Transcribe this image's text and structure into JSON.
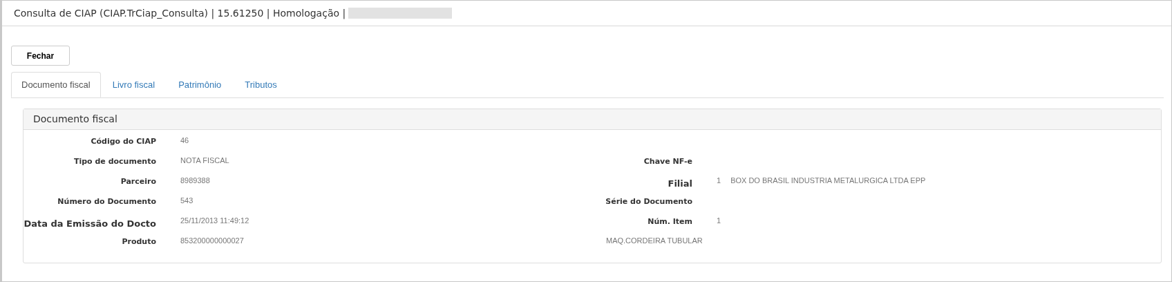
{
  "window": {
    "title": "Consulta de CIAP (CIAP.TrCiap_Consulta) | 15.61250 | Homologação |",
    "redacted": true
  },
  "buttons": [
    {
      "label": "Fechar"
    }
  ],
  "tabs": [
    {
      "label": "Documento fiscal",
      "selected": true
    },
    {
      "label": "Livro fiscal",
      "selected": false
    },
    {
      "label": "Patrimônio",
      "selected": false
    },
    {
      "label": "Tributos",
      "selected": false
    }
  ],
  "panel": {
    "title": "Documento fiscal",
    "rows": [
      {
        "left": {
          "label": "Código do CIAP",
          "emphasis": false,
          "values": [
            "46"
          ]
        }
      },
      {
        "left": {
          "label": "Tipo de documento",
          "emphasis": false,
          "values": [
            "NOTA FISCAL"
          ]
        },
        "right": {
          "label": "Chave NF-e",
          "emphasis": false
        }
      },
      {
        "left": {
          "label": "Parceiro",
          "emphasis": false,
          "values": [
            "8989388"
          ]
        },
        "right": {
          "label": "Filial",
          "emphasis": true,
          "values": [
            "1",
            "BOX DO BRASIL INDUSTRIA METALURGICA LTDA EPP"
          ]
        }
      },
      {
        "left": {
          "label": "Número do Documento",
          "emphasis": false,
          "values": [
            "543"
          ]
        },
        "right": {
          "label": "Série do Documento",
          "emphasis": false
        }
      },
      {
        "left": {
          "label": "Data da Emissão do Docto",
          "emphasis": true,
          "values": [
            "25/11/2013 11:49:12"
          ]
        },
        "right": {
          "label": "Núm. Item",
          "emphasis": false,
          "values": [
            "1"
          ]
        }
      },
      {
        "left": {
          "label": "Produto",
          "emphasis": false,
          "values": [
            "853200000000027"
          ]
        },
        "right": {
          "values": [
            "MAQ.CORDEIRA TUBULAR"
          ]
        }
      }
    ]
  }
}
